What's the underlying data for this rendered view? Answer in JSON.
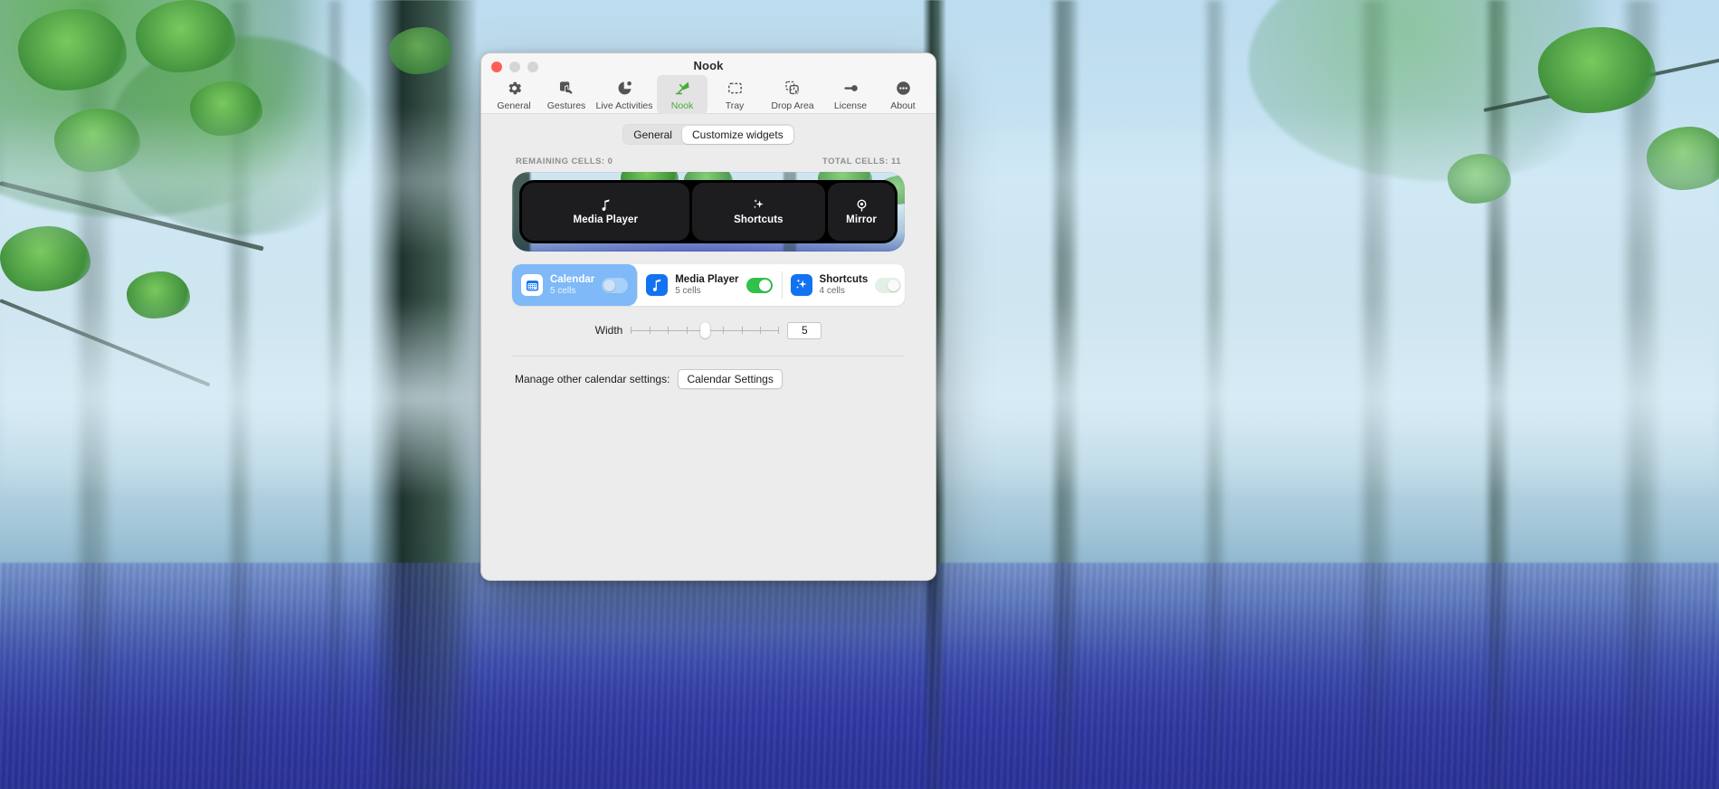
{
  "window": {
    "title": "Nook",
    "traffic_lights": [
      "close",
      "minimize",
      "zoom"
    ]
  },
  "toolbar": {
    "items": [
      {
        "label": "General",
        "icon": "gear-icon",
        "selected": false
      },
      {
        "label": "Gestures",
        "icon": "hand-tap-icon",
        "selected": false
      },
      {
        "label": "Live Activities",
        "icon": "live-activity-icon",
        "selected": false
      },
      {
        "label": "Nook",
        "icon": "desk-lamp-icon",
        "selected": true
      },
      {
        "label": "Tray",
        "icon": "dashed-rect-icon",
        "selected": false
      },
      {
        "label": "Drop Area",
        "icon": "drop-area-icon",
        "selected": false
      },
      {
        "label": "License",
        "icon": "key-icon",
        "selected": false
      },
      {
        "label": "About",
        "icon": "ellipsis-circle-icon",
        "selected": false
      }
    ]
  },
  "tabs": {
    "items": [
      {
        "label": "General",
        "active": false
      },
      {
        "label": "Customize widgets",
        "active": true
      }
    ]
  },
  "stats": {
    "remaining_label": "REMAINING CELLS: 0",
    "total_label": "TOTAL CELLS: 11"
  },
  "preview": {
    "widgets": [
      {
        "label": "Media Player",
        "icon": "music-note-icon",
        "cells": 5
      },
      {
        "label": "Shortcuts",
        "icon": "sparkles-icon",
        "cells": 4
      },
      {
        "label": "Mirror",
        "icon": "webcam-icon",
        "cells": 2
      }
    ]
  },
  "widget_list": {
    "items": [
      {
        "name": "Calendar",
        "cells_label": "5 cells",
        "icon": "calendar-icon",
        "icon_style": "white",
        "selected": true,
        "toggle": "off"
      },
      {
        "name": "Media Player",
        "cells_label": "5 cells",
        "icon": "music-note-icon",
        "icon_style": "blue",
        "selected": false,
        "toggle": "on"
      },
      {
        "name": "Shortcuts",
        "cells_label": "4 cells",
        "icon": "sparkles-icon",
        "icon_style": "blue",
        "selected": false,
        "toggle": "ghost"
      }
    ]
  },
  "width_control": {
    "label": "Width",
    "value": "5",
    "min": 1,
    "max": 9,
    "ticks": 9
  },
  "calendar_settings": {
    "label": "Manage other calendar settings:",
    "button_label": "Calendar Settings"
  },
  "colors": {
    "accent_green": "#4aa83d",
    "widget_blue": "#1272f0",
    "selected_row": "#7fb9f7",
    "toggle_on": "#2fc24b",
    "window_bg": "#ececec",
    "titlebar_bg": "#f6f6f6"
  }
}
